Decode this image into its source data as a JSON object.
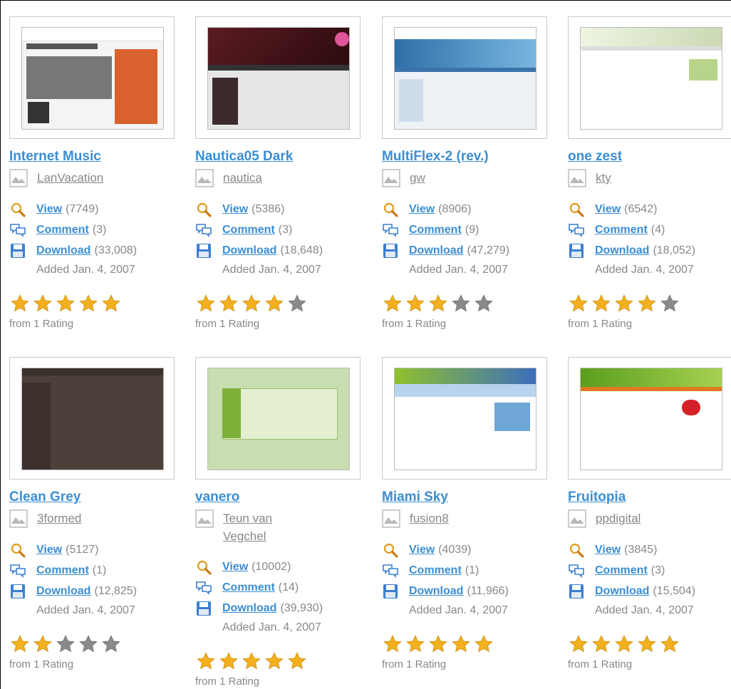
{
  "theme": {
    "link": "#3b8ed4",
    "muted": "#888888",
    "star_on": "#f2b01e",
    "star_off": "#8a8a8a"
  },
  "cards": [
    {
      "title": "Internet Music",
      "author": "LanVacation",
      "view": "View",
      "views": "(7749)",
      "comment": "Comment",
      "comments": "(3)",
      "download": "Download",
      "downloads": "(33,008)",
      "added": "Added Jan. 4, 2007",
      "stars": 5,
      "rating": "from 1 Rating",
      "thumb": "internet-music"
    },
    {
      "title": "Nautica05 Dark",
      "author": "nautica",
      "view": "View",
      "views": "(5386)",
      "comment": "Comment",
      "comments": "(3)",
      "download": "Download",
      "downloads": "(18,648)",
      "added": "Added Jan. 4, 2007",
      "stars": 4,
      "rating": "from 1 Rating",
      "thumb": "nautica"
    },
    {
      "title": "MultiFlex-2 (rev.)",
      "author": "gw",
      "view": "View",
      "views": "(8906)",
      "comment": "Comment",
      "comments": "(9)",
      "download": "Download",
      "downloads": "(47,279)",
      "added": "Added Jan. 4, 2007",
      "stars": 3,
      "rating": "from 1 Rating",
      "thumb": "multiflex"
    },
    {
      "title": "one zest",
      "author": "kty",
      "view": "View",
      "views": "(6542)",
      "comment": "Comment",
      "comments": "(4)",
      "download": "Download",
      "downloads": "(18,052)",
      "added": "Added Jan. 4, 2007",
      "stars": 4,
      "rating": "from 1 Rating",
      "thumb": "onezest"
    },
    {
      "title": "Clean Grey",
      "author": "3formed",
      "view": "View",
      "views": "(5127)",
      "comment": "Comment",
      "comments": "(1)",
      "download": "Download",
      "downloads": "(12,825)",
      "added": "Added Jan. 4, 2007",
      "stars": 2,
      "rating": "from 1 Rating",
      "thumb": "cleangrey"
    },
    {
      "title": "vanero",
      "author": "Teun van Vegchel",
      "view": "View",
      "views": "(10002)",
      "comment": "Comment",
      "comments": "(14)",
      "download": "Download",
      "downloads": "(39,930)",
      "added": "Added Jan. 4, 2007",
      "stars": 5,
      "rating": "from 1 Rating",
      "thumb": "vanero"
    },
    {
      "title": "Miami Sky",
      "author": "fusion8",
      "view": "View",
      "views": "(4039)",
      "comment": "Comment",
      "comments": "(1)",
      "download": "Download",
      "downloads": "(11,966)",
      "added": "Added Jan. 4, 2007",
      "stars": 5,
      "rating": "from 1 Rating",
      "thumb": "miami"
    },
    {
      "title": "Fruitopia",
      "author": "ppdigital",
      "view": "View",
      "views": "(3845)",
      "comment": "Comment",
      "comments": "(3)",
      "download": "Download",
      "downloads": "(15,504)",
      "added": "Added Jan. 4, 2007",
      "stars": 5,
      "rating": "from 1 Rating",
      "thumb": "fruitopia"
    }
  ]
}
